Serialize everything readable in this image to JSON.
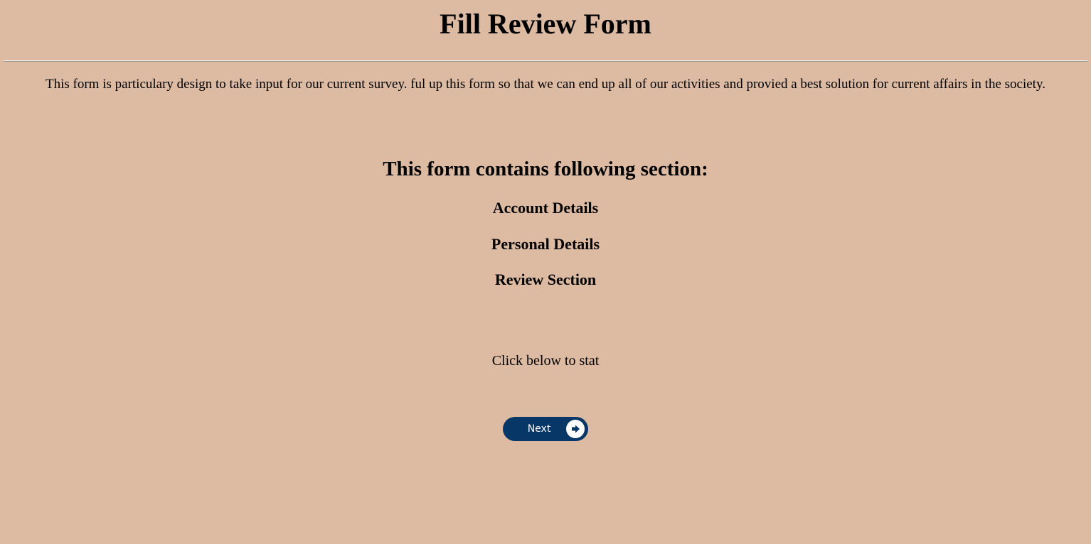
{
  "page": {
    "title": "Fill Review Form",
    "intro": "This form is particulary design to take input for our current survey. ful up this form so that we can end up all of our activities and provied a best solution for current affairs in the society.",
    "sections_heading": "This form contains following section:",
    "sections": [
      "Account Details",
      "Personal Details",
      "Review Section"
    ],
    "start_text": "Click below to stat"
  },
  "next_button": {
    "label": "Next",
    "icon": "arrow-right-circle-icon"
  },
  "colors": {
    "background": "#ddbaa2",
    "button": "#063766",
    "button_text": "#ffffff"
  }
}
